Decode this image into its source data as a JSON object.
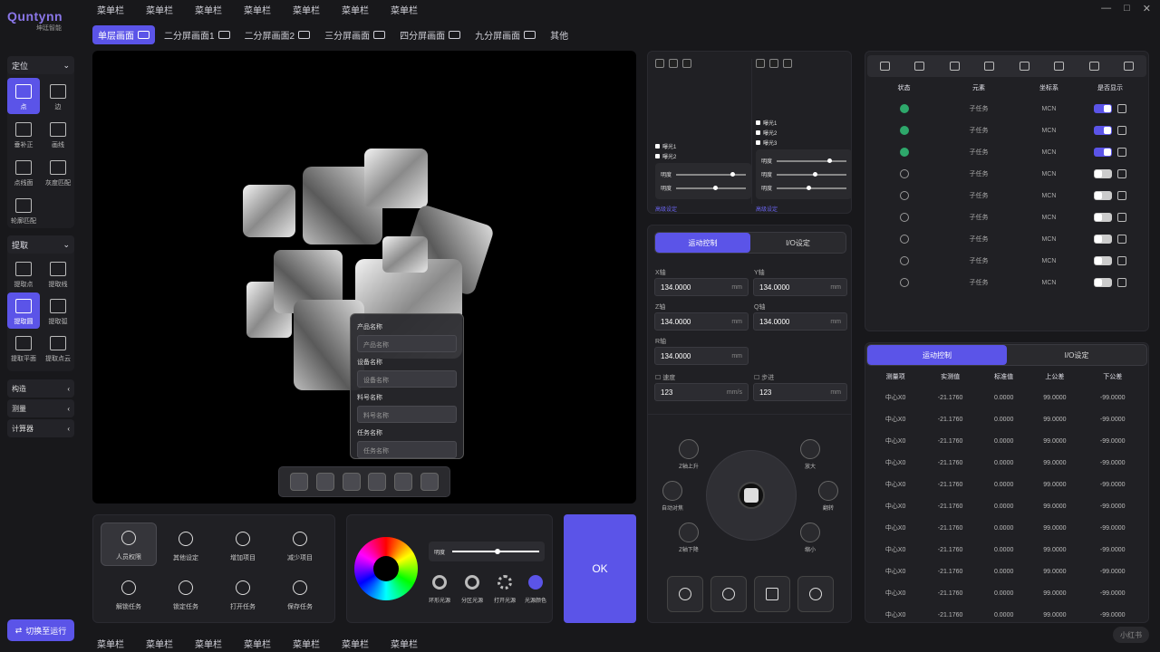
{
  "app": {
    "logo_text": "Quntynn",
    "logo_sub": "坤廷智能"
  },
  "top_menu": [
    "菜单栏",
    "菜单栏",
    "菜单栏",
    "菜单栏",
    "菜单栏",
    "菜单栏",
    "菜单栏"
  ],
  "bottom_menu": [
    "菜单栏",
    "菜单栏",
    "菜单栏",
    "菜单栏",
    "菜单栏",
    "菜单栏",
    "菜单栏"
  ],
  "window_controls": [
    "—",
    "□",
    "✕"
  ],
  "view_tabs": [
    {
      "label": "单层画面",
      "active": true
    },
    {
      "label": "二分屏画面1"
    },
    {
      "label": "二分屏画面2"
    },
    {
      "label": "三分屏画面"
    },
    {
      "label": "四分屏画面"
    },
    {
      "label": "九分屏画面"
    },
    {
      "label": "其他"
    }
  ],
  "sidebar": {
    "locate": {
      "title": "定位",
      "tools": [
        "点",
        "边",
        "垂补正",
        "画线",
        "点线面",
        "灰度匹配",
        "轮廓匹配"
      ]
    },
    "extract": {
      "title": "提取",
      "tools": [
        "提取点",
        "提取线",
        "提取圆",
        "提取弧",
        "提取平面",
        "提取点云"
      ]
    },
    "sections": [
      "构造",
      "测量",
      "计算器"
    ],
    "run_button": "切换至运行"
  },
  "viewer_form": {
    "product_label": "产品名称",
    "product_placeholder": "产品名称",
    "device_label": "设备名称",
    "device_placeholder": "设备名称",
    "material_label": "料号名称",
    "material_placeholder": "料号名称",
    "task_label": "任务名称",
    "task_placeholder": "任务名称"
  },
  "actions": [
    "人员权限",
    "其他设定",
    "增加项目",
    "减少项目",
    "解锁任务",
    "锁定任务",
    "打开任务",
    "保存任务"
  ],
  "light": {
    "brightness_label": "明度",
    "brightness": 0.52,
    "sources": [
      "环形光源",
      "分区光源",
      "打开光源",
      "光源颜色"
    ]
  },
  "ok_button": "OK",
  "cam1": {
    "exposures": [
      "曝光1",
      "曝光2"
    ],
    "sliders": [
      {
        "label": "明度",
        "value": 0.8
      },
      {
        "label": "明度",
        "value": 0.56
      }
    ],
    "link": "高级设定"
  },
  "cam2": {
    "exposures": [
      "曝光1",
      "曝光2",
      "曝光3"
    ],
    "sliders": [
      {
        "label": "明度",
        "value": 0.75
      },
      {
        "label": "明度",
        "value": 0.55
      },
      {
        "label": "明度",
        "value": 0.45
      }
    ],
    "link": "高级设定"
  },
  "motion": {
    "tabs": [
      "运动控制",
      "I/O设定"
    ],
    "axes": [
      {
        "label": "X轴",
        "value": "134.0000",
        "unit": "mm"
      },
      {
        "label": "Y轴",
        "value": "134.0000",
        "unit": "mm"
      },
      {
        "label": "Z轴",
        "value": "134.0000",
        "unit": "mm"
      },
      {
        "label": "Q轴",
        "value": "134.0000",
        "unit": "mm"
      },
      {
        "label": "R轴",
        "value": "134.0000",
        "unit": "mm"
      }
    ],
    "speed": {
      "label": "速度",
      "value": "123",
      "unit": "mm/s"
    },
    "step": {
      "label": "步进",
      "value": "123",
      "unit": "mm"
    },
    "jog": [
      "Z轴上升",
      "放大",
      "自动对焦",
      "翻转",
      "Z轴下降",
      "缩小"
    ]
  },
  "elements": {
    "headers": [
      "状态",
      "元素",
      "坐标系",
      "是否显示"
    ],
    "rows": [
      {
        "ok": true,
        "name": "子任务",
        "coord": "MCN",
        "shown": true
      },
      {
        "ok": true,
        "name": "子任务",
        "coord": "MCN",
        "shown": true
      },
      {
        "ok": true,
        "name": "子任务",
        "coord": "MCN",
        "shown": true
      },
      {
        "ok": false,
        "name": "子任务",
        "coord": "MCN",
        "shown": false
      },
      {
        "ok": false,
        "name": "子任务",
        "coord": "MCN",
        "shown": false
      },
      {
        "ok": false,
        "name": "子任务",
        "coord": "MCN",
        "shown": false
      },
      {
        "ok": false,
        "name": "子任务",
        "coord": "MCN",
        "shown": false
      },
      {
        "ok": false,
        "name": "子任务",
        "coord": "MCN",
        "shown": false
      },
      {
        "ok": false,
        "name": "子任务",
        "coord": "MCN",
        "shown": false
      }
    ]
  },
  "measure": {
    "tabs": [
      "运动控制",
      "I/O设定"
    ],
    "headers": [
      "测量项",
      "实测值",
      "标准值",
      "上公差",
      "下公差"
    ],
    "rows": [
      [
        "中心X0",
        "-21.1760",
        "0.0000",
        "99.0000",
        "-99.0000"
      ],
      [
        "中心X0",
        "-21.1760",
        "0.0000",
        "99.0000",
        "-99.0000"
      ],
      [
        "中心X0",
        "-21.1760",
        "0.0000",
        "99.0000",
        "-99.0000"
      ],
      [
        "中心X0",
        "-21.1760",
        "0.0000",
        "99.0000",
        "-99.0000"
      ],
      [
        "中心X0",
        "-21.1760",
        "0.0000",
        "99.0000",
        "-99.0000"
      ],
      [
        "中心X0",
        "-21.1760",
        "0.0000",
        "99.0000",
        "-99.0000"
      ],
      [
        "中心X0",
        "-21.1760",
        "0.0000",
        "99.0000",
        "-99.0000"
      ],
      [
        "中心X0",
        "-21.1760",
        "0.0000",
        "99.0000",
        "-99.0000"
      ],
      [
        "中心X0",
        "-21.1760",
        "0.0000",
        "99.0000",
        "-99.0000"
      ],
      [
        "中心X0",
        "-21.1760",
        "0.0000",
        "99.0000",
        "-99.0000"
      ],
      [
        "中心X0",
        "-21.1760",
        "0.0000",
        "99.0000",
        "-99.0000"
      ]
    ]
  },
  "watermark": "小红书",
  "colors": {
    "accent": "#5b54e8",
    "ok": "#2ea86b",
    "bg": "#18181b",
    "panel": "#202024"
  }
}
